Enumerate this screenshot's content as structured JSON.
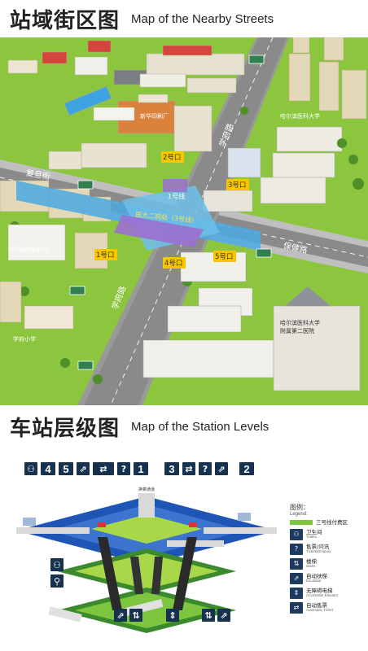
{
  "section1": {
    "title_cn": "站域街区图",
    "title_en": "Map of the Nearby Streets"
  },
  "section2": {
    "title_cn": "车站层级图",
    "title_en": "Map of the Station Levels"
  },
  "map": {
    "streets": {
      "xueqi_road_top": "学府路",
      "xueqi_road_bottom": "学府路",
      "fudan_street": "复旦街",
      "baojian_road": "保健路"
    },
    "exits": [
      "1号口",
      "2号口",
      "3号口",
      "4号口",
      "5号口"
    ],
    "line_label": "1号线",
    "station_label": "医大二院站（3号线）",
    "places": {
      "xinhua_printing": "新华印刷厂",
      "harbin_medical_univ": "哈尔滨医科大学",
      "pharma_factory": "哈药集团制药总厂",
      "xuefu_primary": "学府小学",
      "second_hospital_line1": "哈尔滨医科大学",
      "second_hospital_line2": "附属第二医院"
    }
  },
  "levels": {
    "top_icons": [
      "toilet",
      "4",
      "5",
      "escalator",
      "ticket",
      "?",
      "1",
      "3",
      "ticket-machine",
      "?",
      "info",
      "2"
    ],
    "top_numbers": {
      "n4": "4",
      "n5": "5",
      "n1": "1",
      "n3": "3",
      "n2": "2",
      "q": "?"
    },
    "center_tag": "换乘通道",
    "legend": {
      "title": "图例：",
      "title_en": "Legend:",
      "items": [
        {
          "cn": "三号线付费区",
          "en": ""
        },
        {
          "cn": "卫生间",
          "en": "Toilets"
        },
        {
          "cn": "售票/问讯",
          "en": "Tickets/Enquiry"
        },
        {
          "cn": "楼梯",
          "en": "Stairs"
        },
        {
          "cn": "自动扶梯",
          "en": "Escalator"
        },
        {
          "cn": "无障碍电梯",
          "en": "Accessible Elevator"
        },
        {
          "cn": "自动售票",
          "en": "Automatic Ticket"
        }
      ]
    }
  },
  "colors": {
    "grass": "#8cc63f",
    "road": "#8a8a8a",
    "platform_blue": "#4aa8e0",
    "station_purple": "#9b6fd0",
    "exit_yellow": "#f7c600",
    "deck_blue": "#1f55b4",
    "legend_icon": "#16324f"
  }
}
